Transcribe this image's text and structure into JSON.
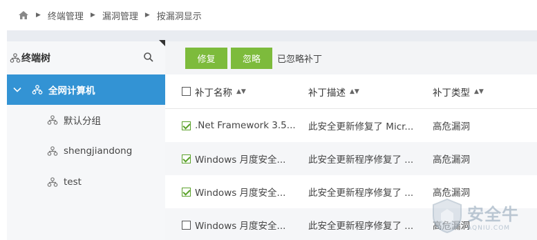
{
  "breadcrumb": {
    "items": [
      "终端管理",
      "漏洞管理",
      "按漏洞显示"
    ]
  },
  "sidebar": {
    "title": "终端树",
    "root": "全网计算机",
    "children": [
      "默认分组",
      "shengjiandong",
      "test"
    ]
  },
  "toolbar": {
    "fix_label": "修复",
    "ignore_label": "忽略",
    "ignored_label": "已忽略补丁"
  },
  "table": {
    "columns": [
      "补丁名称",
      "补丁描述",
      "补丁类型"
    ],
    "rows": [
      {
        "name": ".Net Framework 3.5...",
        "desc": "此安全更新修复了 Micr...",
        "type": "高危漏洞",
        "checked": true
      },
      {
        "name": "Windows 月度安全...",
        "desc": "此安全更新程序修复了 ...",
        "type": "高危漏洞",
        "checked": true
      },
      {
        "name": "Windows 月度安全...",
        "desc": "此安全更新程序修复了 ...",
        "type": "高危漏洞",
        "checked": true
      },
      {
        "name": "Windows 月度安全...",
        "desc": "此安全更新程序修复了 ...",
        "type": "高危漏洞",
        "checked": false
      }
    ]
  },
  "watermark": {
    "main": "安全牛",
    "sub": "AQNIU.COM"
  },
  "colors": {
    "accent_blue": "#3393d4",
    "button_green": "#7dbb3c",
    "check_green": "#5aa12a"
  }
}
